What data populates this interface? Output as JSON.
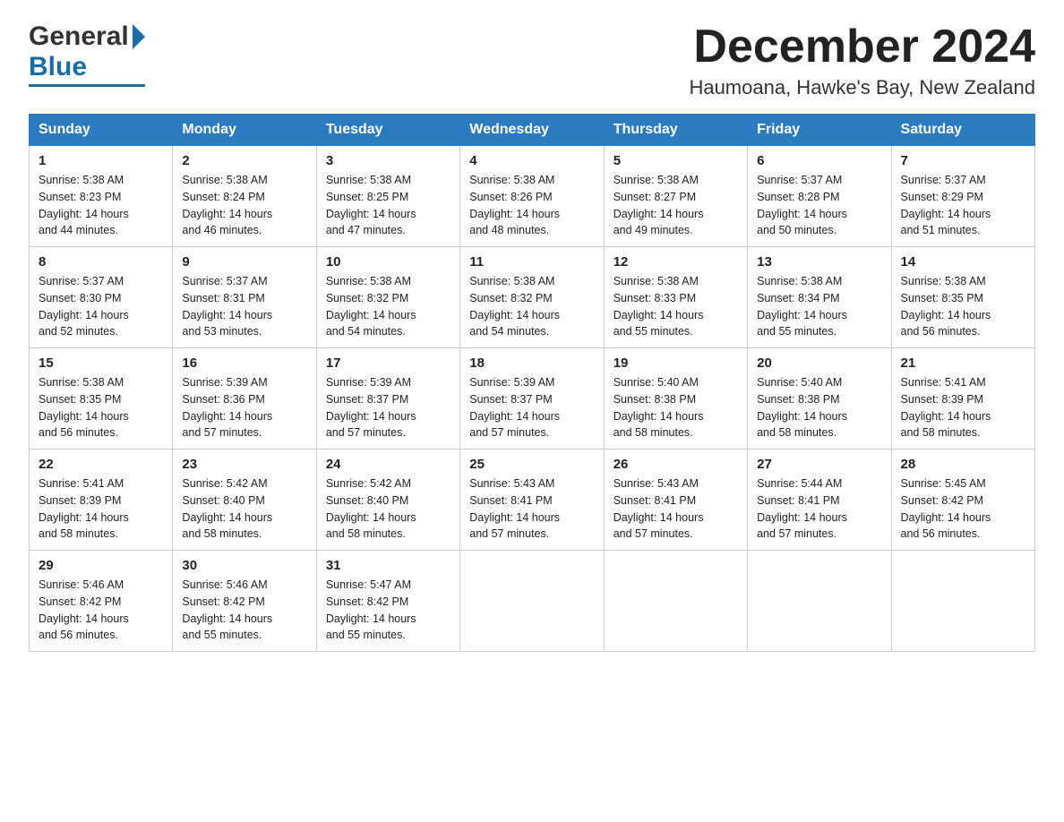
{
  "logo": {
    "general": "General",
    "blue": "Blue"
  },
  "header": {
    "month": "December 2024",
    "location": "Haumoana, Hawke's Bay, New Zealand"
  },
  "days_of_week": [
    "Sunday",
    "Monday",
    "Tuesday",
    "Wednesday",
    "Thursday",
    "Friday",
    "Saturday"
  ],
  "weeks": [
    [
      {
        "day": "1",
        "sunrise": "5:38 AM",
        "sunset": "8:23 PM",
        "daylight_h": "14",
        "daylight_m": "44"
      },
      {
        "day": "2",
        "sunrise": "5:38 AM",
        "sunset": "8:24 PM",
        "daylight_h": "14",
        "daylight_m": "46"
      },
      {
        "day": "3",
        "sunrise": "5:38 AM",
        "sunset": "8:25 PM",
        "daylight_h": "14",
        "daylight_m": "47"
      },
      {
        "day": "4",
        "sunrise": "5:38 AM",
        "sunset": "8:26 PM",
        "daylight_h": "14",
        "daylight_m": "48"
      },
      {
        "day": "5",
        "sunrise": "5:38 AM",
        "sunset": "8:27 PM",
        "daylight_h": "14",
        "daylight_m": "49"
      },
      {
        "day": "6",
        "sunrise": "5:37 AM",
        "sunset": "8:28 PM",
        "daylight_h": "14",
        "daylight_m": "50"
      },
      {
        "day": "7",
        "sunrise": "5:37 AM",
        "sunset": "8:29 PM",
        "daylight_h": "14",
        "daylight_m": "51"
      }
    ],
    [
      {
        "day": "8",
        "sunrise": "5:37 AM",
        "sunset": "8:30 PM",
        "daylight_h": "14",
        "daylight_m": "52"
      },
      {
        "day": "9",
        "sunrise": "5:37 AM",
        "sunset": "8:31 PM",
        "daylight_h": "14",
        "daylight_m": "53"
      },
      {
        "day": "10",
        "sunrise": "5:38 AM",
        "sunset": "8:32 PM",
        "daylight_h": "14",
        "daylight_m": "54"
      },
      {
        "day": "11",
        "sunrise": "5:38 AM",
        "sunset": "8:32 PM",
        "daylight_h": "14",
        "daylight_m": "54"
      },
      {
        "day": "12",
        "sunrise": "5:38 AM",
        "sunset": "8:33 PM",
        "daylight_h": "14",
        "daylight_m": "55"
      },
      {
        "day": "13",
        "sunrise": "5:38 AM",
        "sunset": "8:34 PM",
        "daylight_h": "14",
        "daylight_m": "55"
      },
      {
        "day": "14",
        "sunrise": "5:38 AM",
        "sunset": "8:35 PM",
        "daylight_h": "14",
        "daylight_m": "56"
      }
    ],
    [
      {
        "day": "15",
        "sunrise": "5:38 AM",
        "sunset": "8:35 PM",
        "daylight_h": "14",
        "daylight_m": "56"
      },
      {
        "day": "16",
        "sunrise": "5:39 AM",
        "sunset": "8:36 PM",
        "daylight_h": "14",
        "daylight_m": "57"
      },
      {
        "day": "17",
        "sunrise": "5:39 AM",
        "sunset": "8:37 PM",
        "daylight_h": "14",
        "daylight_m": "57"
      },
      {
        "day": "18",
        "sunrise": "5:39 AM",
        "sunset": "8:37 PM",
        "daylight_h": "14",
        "daylight_m": "57"
      },
      {
        "day": "19",
        "sunrise": "5:40 AM",
        "sunset": "8:38 PM",
        "daylight_h": "14",
        "daylight_m": "58"
      },
      {
        "day": "20",
        "sunrise": "5:40 AM",
        "sunset": "8:38 PM",
        "daylight_h": "14",
        "daylight_m": "58"
      },
      {
        "day": "21",
        "sunrise": "5:41 AM",
        "sunset": "8:39 PM",
        "daylight_h": "14",
        "daylight_m": "58"
      }
    ],
    [
      {
        "day": "22",
        "sunrise": "5:41 AM",
        "sunset": "8:39 PM",
        "daylight_h": "14",
        "daylight_m": "58"
      },
      {
        "day": "23",
        "sunrise": "5:42 AM",
        "sunset": "8:40 PM",
        "daylight_h": "14",
        "daylight_m": "58"
      },
      {
        "day": "24",
        "sunrise": "5:42 AM",
        "sunset": "8:40 PM",
        "daylight_h": "14",
        "daylight_m": "58"
      },
      {
        "day": "25",
        "sunrise": "5:43 AM",
        "sunset": "8:41 PM",
        "daylight_h": "14",
        "daylight_m": "57"
      },
      {
        "day": "26",
        "sunrise": "5:43 AM",
        "sunset": "8:41 PM",
        "daylight_h": "14",
        "daylight_m": "57"
      },
      {
        "day": "27",
        "sunrise": "5:44 AM",
        "sunset": "8:41 PM",
        "daylight_h": "14",
        "daylight_m": "57"
      },
      {
        "day": "28",
        "sunrise": "5:45 AM",
        "sunset": "8:42 PM",
        "daylight_h": "14",
        "daylight_m": "56"
      }
    ],
    [
      {
        "day": "29",
        "sunrise": "5:46 AM",
        "sunset": "8:42 PM",
        "daylight_h": "14",
        "daylight_m": "56"
      },
      {
        "day": "30",
        "sunrise": "5:46 AM",
        "sunset": "8:42 PM",
        "daylight_h": "14",
        "daylight_m": "55"
      },
      {
        "day": "31",
        "sunrise": "5:47 AM",
        "sunset": "8:42 PM",
        "daylight_h": "14",
        "daylight_m": "55"
      },
      null,
      null,
      null,
      null
    ]
  ]
}
